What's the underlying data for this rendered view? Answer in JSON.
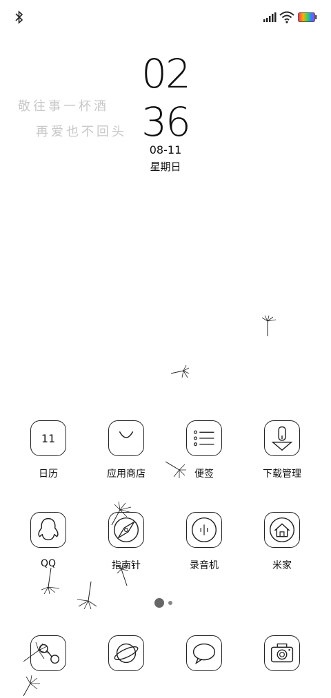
{
  "status_bar": {
    "left_icon": "bluetooth-icon",
    "right_icons": [
      "signal-icon",
      "wifi-icon",
      "battery-icon"
    ]
  },
  "lock_clock": {
    "hours": "02",
    "minutes": "36",
    "date": "08-11",
    "weekday": "星期日"
  },
  "poem": {
    "line1": "敬往事一杯酒",
    "line2": "再爱也不回头"
  },
  "apps_row1": [
    {
      "label": "日历",
      "icon": "calendar-icon",
      "icon_text": "11"
    },
    {
      "label": "应用商店",
      "icon": "app-store-icon"
    },
    {
      "label": "便签",
      "icon": "notes-icon"
    },
    {
      "label": "下载管理",
      "icon": "download-icon"
    }
  ],
  "apps_row2": [
    {
      "label": "QQ",
      "icon": "qq-icon"
    },
    {
      "label": "指南针",
      "icon": "compass-icon"
    },
    {
      "label": "录音机",
      "icon": "recorder-icon"
    },
    {
      "label": "米家",
      "icon": "home-icon"
    }
  ],
  "dock": [
    {
      "icon": "phone-icon"
    },
    {
      "icon": "browser-icon"
    },
    {
      "icon": "messages-icon"
    },
    {
      "icon": "camera-icon"
    }
  ],
  "page_indicator": {
    "pages": 2,
    "current": 1
  },
  "colors": {
    "background": "#ffffff",
    "stroke": "#222222",
    "poem": "#c8c8c8",
    "battery": "rainbow"
  }
}
